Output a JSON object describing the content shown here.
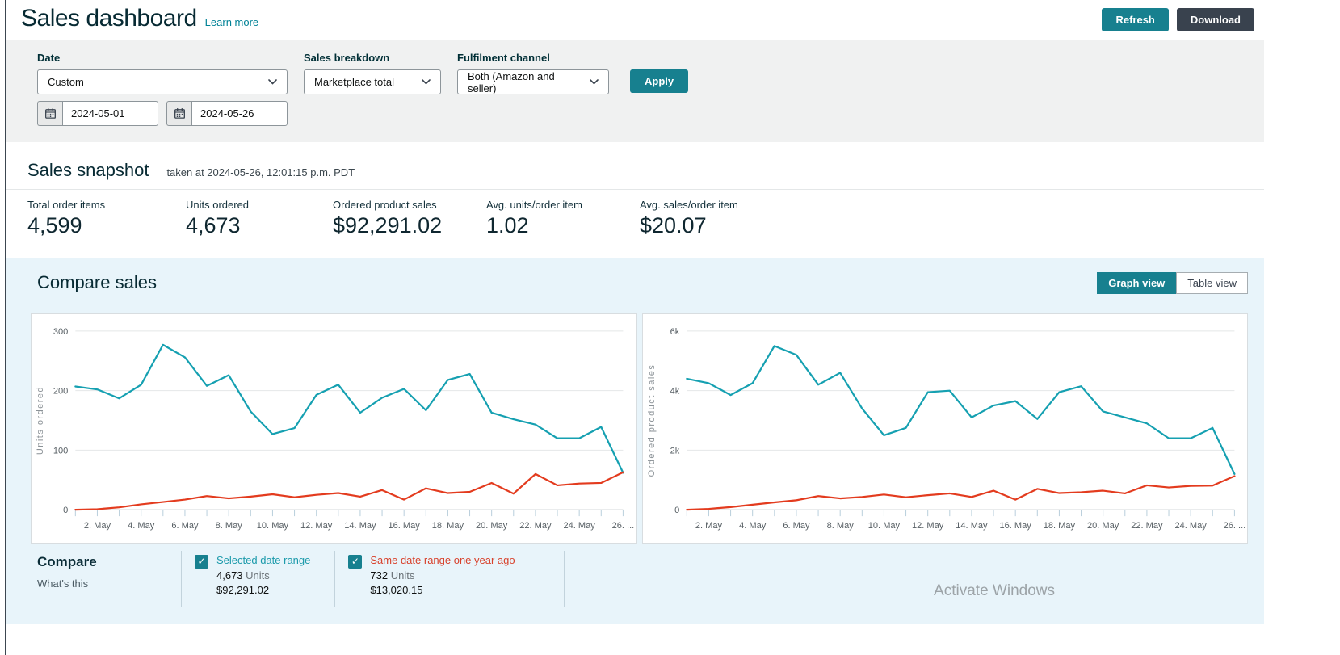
{
  "page": {
    "title": "Sales dashboard",
    "learn_more": "Learn more"
  },
  "header": {
    "refresh_label": "Refresh",
    "download_label": "Download"
  },
  "filters": {
    "date_label": "Date",
    "date_value": "Custom",
    "date_from": "2024-05-01",
    "date_to": "2024-05-26",
    "sales_breakdown_label": "Sales breakdown",
    "sales_breakdown_value": "Marketplace total",
    "fulfilment_label": "Fulfilment channel",
    "fulfilment_value": "Both (Amazon and seller)",
    "apply_label": "Apply"
  },
  "snapshot": {
    "title": "Sales snapshot",
    "taken_at": "taken at 2024-05-26, 12:01:15 p.m. PDT",
    "stats": [
      {
        "label": "Total order items",
        "value": "4,599"
      },
      {
        "label": "Units ordered",
        "value": "4,673"
      },
      {
        "label": "Ordered product sales",
        "value": "$92,291.02"
      },
      {
        "label": "Avg. units/order item",
        "value": "1.02"
      },
      {
        "label": "Avg. sales/order item",
        "value": "$20.07"
      }
    ]
  },
  "compare": {
    "title": "Compare sales",
    "graph_view_label": "Graph view",
    "table_view_label": "Table view",
    "legend_title": "Compare",
    "whats_this": "What's this",
    "items": [
      {
        "label": "Selected date range",
        "units_value": "4,673",
        "units_suffix": "Units",
        "sales": "$92,291.02",
        "color": "#1b9aab"
      },
      {
        "label": "Same date range one year ago",
        "units_value": "732",
        "units_suffix": "Units",
        "sales": "$13,020.15",
        "color": "#d8412b"
      }
    ]
  },
  "icons": {
    "check": "✓"
  },
  "watermark": "Activate Windows",
  "colors": {
    "accent_teal": "#17808f",
    "dark_slate": "#39424e",
    "link_teal": "#008296",
    "filter_bg": "#f0f1f1",
    "compare_bg": "#e8f4fa"
  },
  "chart_data": [
    {
      "type": "line",
      "title": "Units ordered (compare sales, 2024-05-01 to 2024-05-26)",
      "xlabel": "",
      "ylabel": "Units ordered",
      "ylim": [
        0,
        300
      ],
      "yticks": [
        0,
        100,
        200,
        300
      ],
      "ytick_labels": [
        "0",
        "100",
        "200",
        "300"
      ],
      "grid": true,
      "legend_position": "below-charts",
      "x_days": [
        1,
        2,
        3,
        4,
        5,
        6,
        7,
        8,
        9,
        10,
        11,
        12,
        13,
        14,
        15,
        16,
        17,
        18,
        19,
        20,
        21,
        22,
        23,
        24,
        25,
        26
      ],
      "xticks": [
        {
          "i": 1,
          "label": "2. May"
        },
        {
          "i": 3,
          "label": "4. May"
        },
        {
          "i": 5,
          "label": "6. May"
        },
        {
          "i": 7,
          "label": "8. May"
        },
        {
          "i": 9,
          "label": "10. May"
        },
        {
          "i": 11,
          "label": "12. May"
        },
        {
          "i": 13,
          "label": "14. May"
        },
        {
          "i": 15,
          "label": "16. May"
        },
        {
          "i": 17,
          "label": "18. May"
        },
        {
          "i": 19,
          "label": "20. May"
        },
        {
          "i": 21,
          "label": "22. May"
        },
        {
          "i": 23,
          "label": "24. May"
        },
        {
          "i": 25,
          "label": "26. ..."
        }
      ],
      "series": [
        {
          "name": "Selected date range",
          "color": "#15a0b1",
          "values": [
            207,
            202,
            187,
            210,
            277,
            256,
            208,
            226,
            165,
            127,
            137,
            193,
            210,
            163,
            188,
            203,
            167,
            218,
            228,
            163,
            152,
            143,
            120,
            120,
            139,
            62
          ]
        },
        {
          "name": "Same date range one year ago",
          "color": "#e33b1e",
          "values": [
            0,
            1,
            4,
            9,
            13,
            17,
            23,
            19,
            22,
            26,
            21,
            25,
            28,
            22,
            33,
            17,
            36,
            28,
            30,
            45,
            27,
            60,
            41,
            44,
            45,
            63
          ]
        }
      ]
    },
    {
      "type": "line",
      "title": "Ordered product sales (compare sales, 2024-05-01 to 2024-05-26)",
      "xlabel": "",
      "ylabel": "Ordered product sales",
      "ylim": [
        0,
        6000
      ],
      "yticks": [
        0,
        2000,
        4000,
        6000
      ],
      "ytick_labels": [
        "0",
        "2k",
        "4k",
        "6k"
      ],
      "grid": true,
      "legend_position": "below-charts",
      "x_days": [
        1,
        2,
        3,
        4,
        5,
        6,
        7,
        8,
        9,
        10,
        11,
        12,
        13,
        14,
        15,
        16,
        17,
        18,
        19,
        20,
        21,
        22,
        23,
        24,
        25,
        26
      ],
      "xticks": [
        {
          "i": 1,
          "label": "2. May"
        },
        {
          "i": 3,
          "label": "4. May"
        },
        {
          "i": 5,
          "label": "6. May"
        },
        {
          "i": 7,
          "label": "8. May"
        },
        {
          "i": 9,
          "label": "10. May"
        },
        {
          "i": 11,
          "label": "12. May"
        },
        {
          "i": 13,
          "label": "14. May"
        },
        {
          "i": 15,
          "label": "16. May"
        },
        {
          "i": 17,
          "label": "18. May"
        },
        {
          "i": 19,
          "label": "20. May"
        },
        {
          "i": 21,
          "label": "22. May"
        },
        {
          "i": 23,
          "label": "24. May"
        },
        {
          "i": 25,
          "label": "26. ..."
        }
      ],
      "series": [
        {
          "name": "Selected date range",
          "color": "#15a0b1",
          "values": [
            4400,
            4250,
            3850,
            4250,
            5500,
            5200,
            4200,
            4600,
            3400,
            2500,
            2750,
            3950,
            4000,
            3100,
            3500,
            3650,
            3050,
            3950,
            4150,
            3300,
            3100,
            2900,
            2400,
            2400,
            2750,
            1200
          ]
        },
        {
          "name": "Same date range one year ago",
          "color": "#e33b1e",
          "values": [
            0,
            30,
            90,
            170,
            250,
            320,
            460,
            380,
            430,
            510,
            420,
            490,
            550,
            430,
            640,
            340,
            700,
            560,
            590,
            640,
            550,
            820,
            750,
            800,
            810,
            1130
          ]
        }
      ]
    }
  ]
}
